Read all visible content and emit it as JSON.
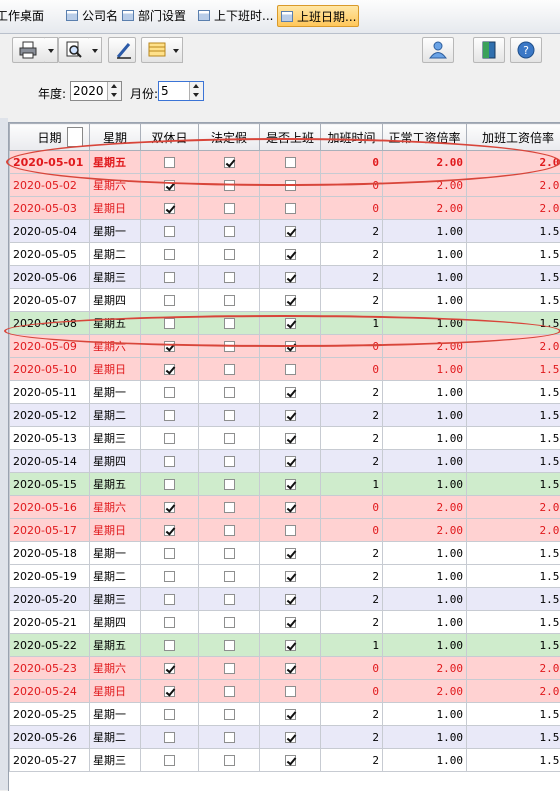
{
  "tabs": [
    {
      "label": "工作桌面"
    },
    {
      "label": "公司名称"
    },
    {
      "label": "部门设置"
    },
    {
      "label": "上下班时..."
    },
    {
      "label": "上班日期..."
    }
  ],
  "toolbar": {
    "left_icons": [
      "printer-icon",
      "preview-icon",
      "edit-pen-icon",
      "export-table-icon"
    ],
    "right_icons": [
      "users-icon",
      "exit-door-icon",
      "help-icon"
    ]
  },
  "filter": {
    "year_label": "年度:",
    "year_value": "2020",
    "month_label": "月份:",
    "month_value": "5"
  },
  "table": {
    "headers": [
      "日期",
      "星期",
      "双休日",
      "法定假",
      "是否上班",
      "加班时间",
      "正常工资倍率",
      "加班工资倍率"
    ],
    "rows": [
      {
        "date": "2020-05-01",
        "weekday": "星期五",
        "weekend": false,
        "holiday": true,
        "work": false,
        "ot": "0",
        "normal": "2.00",
        "otrate": "2.00",
        "style": "red bold"
      },
      {
        "date": "2020-05-02",
        "weekday": "星期六",
        "weekend": true,
        "holiday": false,
        "work": false,
        "ot": "0",
        "normal": "2.00",
        "otrate": "2.00",
        "style": "red"
      },
      {
        "date": "2020-05-03",
        "weekday": "星期日",
        "weekend": true,
        "holiday": false,
        "work": false,
        "ot": "0",
        "normal": "2.00",
        "otrate": "2.00",
        "style": "red"
      },
      {
        "date": "2020-05-04",
        "weekday": "星期一",
        "weekend": false,
        "holiday": false,
        "work": true,
        "ot": "2",
        "normal": "1.00",
        "otrate": "1.50",
        "style": "wk alt"
      },
      {
        "date": "2020-05-05",
        "weekday": "星期二",
        "weekend": false,
        "holiday": false,
        "work": true,
        "ot": "2",
        "normal": "1.00",
        "otrate": "1.50",
        "style": "wk"
      },
      {
        "date": "2020-05-06",
        "weekday": "星期三",
        "weekend": false,
        "holiday": false,
        "work": true,
        "ot": "2",
        "normal": "1.00",
        "otrate": "1.50",
        "style": "wk alt"
      },
      {
        "date": "2020-05-07",
        "weekday": "星期四",
        "weekend": false,
        "holiday": false,
        "work": true,
        "ot": "2",
        "normal": "1.00",
        "otrate": "1.50",
        "style": "wk"
      },
      {
        "date": "2020-05-08",
        "weekday": "星期五",
        "weekend": false,
        "holiday": false,
        "work": true,
        "ot": "1",
        "normal": "1.00",
        "otrate": "1.50",
        "style": "fri"
      },
      {
        "date": "2020-05-09",
        "weekday": "星期六",
        "weekend": true,
        "holiday": false,
        "work": true,
        "ot": "0",
        "normal": "2.00",
        "otrate": "2.00",
        "style": "red"
      },
      {
        "date": "2020-05-10",
        "weekday": "星期日",
        "weekend": true,
        "holiday": false,
        "work": false,
        "ot": "0",
        "normal": "1.00",
        "otrate": "1.50",
        "style": "red"
      },
      {
        "date": "2020-05-11",
        "weekday": "星期一",
        "weekend": false,
        "holiday": false,
        "work": true,
        "ot": "2",
        "normal": "1.00",
        "otrate": "1.50",
        "style": "wk"
      },
      {
        "date": "2020-05-12",
        "weekday": "星期二",
        "weekend": false,
        "holiday": false,
        "work": true,
        "ot": "2",
        "normal": "1.00",
        "otrate": "1.50",
        "style": "wk alt"
      },
      {
        "date": "2020-05-13",
        "weekday": "星期三",
        "weekend": false,
        "holiday": false,
        "work": true,
        "ot": "2",
        "normal": "1.00",
        "otrate": "1.50",
        "style": "wk"
      },
      {
        "date": "2020-05-14",
        "weekday": "星期四",
        "weekend": false,
        "holiday": false,
        "work": true,
        "ot": "2",
        "normal": "1.00",
        "otrate": "1.50",
        "style": "wk alt"
      },
      {
        "date": "2020-05-15",
        "weekday": "星期五",
        "weekend": false,
        "holiday": false,
        "work": true,
        "ot": "1",
        "normal": "1.00",
        "otrate": "1.50",
        "style": "fri"
      },
      {
        "date": "2020-05-16",
        "weekday": "星期六",
        "weekend": true,
        "holiday": false,
        "work": true,
        "ot": "0",
        "normal": "2.00",
        "otrate": "2.00",
        "style": "red"
      },
      {
        "date": "2020-05-17",
        "weekday": "星期日",
        "weekend": true,
        "holiday": false,
        "work": false,
        "ot": "0",
        "normal": "2.00",
        "otrate": "2.00",
        "style": "red"
      },
      {
        "date": "2020-05-18",
        "weekday": "星期一",
        "weekend": false,
        "holiday": false,
        "work": true,
        "ot": "2",
        "normal": "1.00",
        "otrate": "1.50",
        "style": "wk"
      },
      {
        "date": "2020-05-19",
        "weekday": "星期二",
        "weekend": false,
        "holiday": false,
        "work": true,
        "ot": "2",
        "normal": "1.00",
        "otrate": "1.50",
        "style": "wk"
      },
      {
        "date": "2020-05-20",
        "weekday": "星期三",
        "weekend": false,
        "holiday": false,
        "work": true,
        "ot": "2",
        "normal": "1.00",
        "otrate": "1.50",
        "style": "wk alt"
      },
      {
        "date": "2020-05-21",
        "weekday": "星期四",
        "weekend": false,
        "holiday": false,
        "work": true,
        "ot": "2",
        "normal": "1.00",
        "otrate": "1.50",
        "style": "wk"
      },
      {
        "date": "2020-05-22",
        "weekday": "星期五",
        "weekend": false,
        "holiday": false,
        "work": true,
        "ot": "1",
        "normal": "1.00",
        "otrate": "1.50",
        "style": "fri"
      },
      {
        "date": "2020-05-23",
        "weekday": "星期六",
        "weekend": true,
        "holiday": false,
        "work": true,
        "ot": "0",
        "normal": "2.00",
        "otrate": "2.00",
        "style": "red"
      },
      {
        "date": "2020-05-24",
        "weekday": "星期日",
        "weekend": true,
        "holiday": false,
        "work": false,
        "ot": "0",
        "normal": "2.00",
        "otrate": "2.00",
        "style": "red"
      },
      {
        "date": "2020-05-25",
        "weekday": "星期一",
        "weekend": false,
        "holiday": false,
        "work": true,
        "ot": "2",
        "normal": "1.00",
        "otrate": "1.50",
        "style": "wk"
      },
      {
        "date": "2020-05-26",
        "weekday": "星期二",
        "weekend": false,
        "holiday": false,
        "work": true,
        "ot": "2",
        "normal": "1.00",
        "otrate": "1.50",
        "style": "wk alt"
      },
      {
        "date": "2020-05-27",
        "weekday": "星期三",
        "weekend": false,
        "holiday": false,
        "work": true,
        "ot": "2",
        "normal": "1.00",
        "otrate": "1.50",
        "style": "wk"
      }
    ]
  },
  "colors": {
    "highlight_ellipse": "#d8453a",
    "holiday_row": "#ffd2d2",
    "friday_row": "#cfeccc",
    "alt_row": "#e9e9f8",
    "active_tab": "#ffc75a"
  }
}
